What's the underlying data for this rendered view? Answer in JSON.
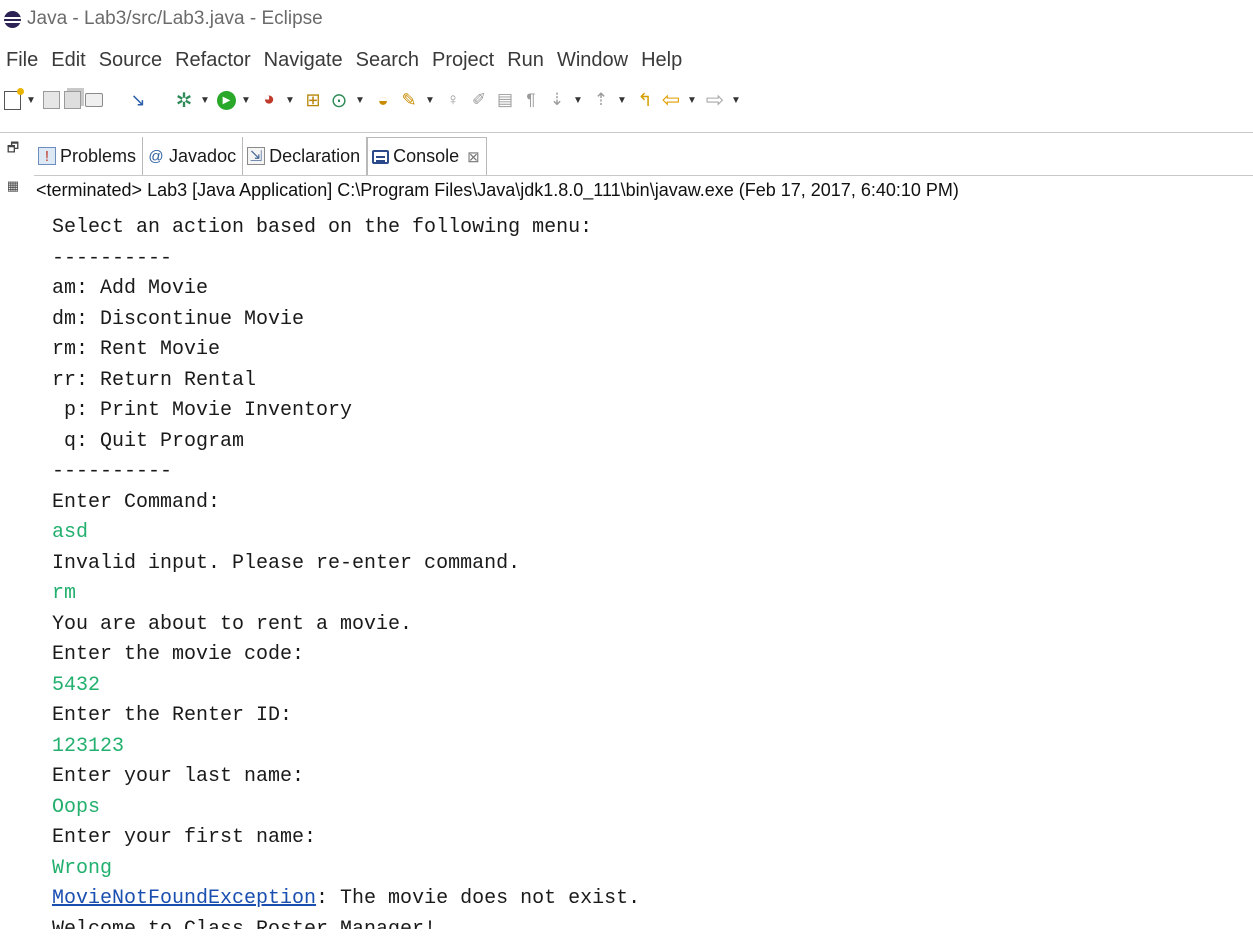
{
  "window": {
    "title": "Java - Lab3/src/Lab3.java - Eclipse"
  },
  "menu": [
    "File",
    "Edit",
    "Source",
    "Refactor",
    "Navigate",
    "Search",
    "Project",
    "Run",
    "Window",
    "Help"
  ],
  "toolbar_icons": [
    "new-icon",
    "save-icon",
    "save-all-icon",
    "print-icon",
    "skip-breakpoints-icon",
    "debug-icon",
    "run-icon",
    "coverage-icon",
    "new-package-icon",
    "new-class-icon",
    "open-type-icon",
    "search-icon",
    "toggle-annotation-icon",
    "mark-occurrences-icon",
    "block-selection-icon",
    "show-whitespace-icon",
    "next-annotation-icon",
    "prev-annotation-icon",
    "last-edit-icon",
    "back-icon",
    "forward-icon"
  ],
  "tabs": [
    {
      "label": "Problems",
      "icon": "problems-icon",
      "active": false
    },
    {
      "label": "Javadoc",
      "icon": "javadoc-icon",
      "active": false
    },
    {
      "label": "Declaration",
      "icon": "declaration-icon",
      "active": false
    },
    {
      "label": "Console",
      "icon": "console-icon",
      "active": true,
      "close": "⊠"
    }
  ],
  "console": {
    "status": "<terminated> Lab3 [Java Application] C:\\Program Files\\Java\\jdk1.8.0_111\\bin\\javaw.exe (Feb 17, 2017, 6:40:10 PM)",
    "lines": [
      {
        "type": "out",
        "text": "Select an action based on the following menu:"
      },
      {
        "type": "out",
        "text": "----------"
      },
      {
        "type": "out",
        "text": "am: Add Movie"
      },
      {
        "type": "out",
        "text": "dm: Discontinue Movie"
      },
      {
        "type": "out",
        "text": "rm: Rent Movie"
      },
      {
        "type": "out",
        "text": "rr: Return Rental"
      },
      {
        "type": "out",
        "text": " p: Print Movie Inventory"
      },
      {
        "type": "out",
        "text": " q: Quit Program"
      },
      {
        "type": "out",
        "text": "----------"
      },
      {
        "type": "out",
        "text": "Enter Command:"
      },
      {
        "type": "in",
        "text": "asd"
      },
      {
        "type": "out",
        "text": "Invalid input. Please re-enter command."
      },
      {
        "type": "in",
        "text": "rm"
      },
      {
        "type": "out",
        "text": "You are about to rent a movie."
      },
      {
        "type": "out",
        "text": "Enter the movie code:"
      },
      {
        "type": "in",
        "text": "5432"
      },
      {
        "type": "out",
        "text": "Enter the Renter ID:"
      },
      {
        "type": "in",
        "text": "123123"
      },
      {
        "type": "out",
        "text": "Enter your last name:"
      },
      {
        "type": "in",
        "text": "Oops"
      },
      {
        "type": "out",
        "text": "Enter your first name:"
      },
      {
        "type": "in",
        "text": "Wrong"
      }
    ],
    "exception": {
      "name": "MovieNotFoundException",
      "message": ": The movie does not exist."
    },
    "clipped_line": "Welcome to Class Roster Manager!"
  },
  "colors": {
    "input": "#23b06e",
    "link": "#1a4fb0",
    "output": "#1a1a1a"
  }
}
